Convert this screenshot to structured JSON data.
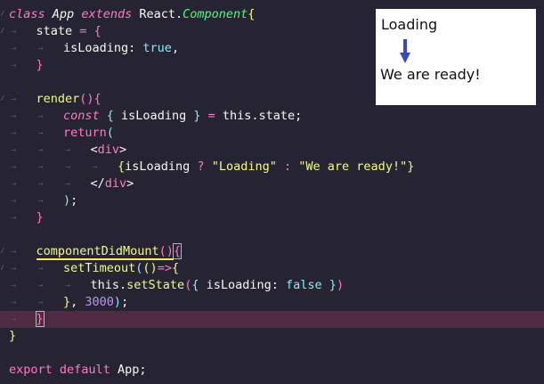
{
  "code_lines": [
    {
      "mark": "⁄",
      "tokens": [
        [
          "kw-i",
          "class"
        ],
        [
          "plain",
          " "
        ],
        [
          "cls",
          "App"
        ],
        [
          "plain",
          " "
        ],
        [
          "ext",
          "extends"
        ],
        [
          "plain",
          " "
        ],
        [
          "plain",
          "React"
        ],
        [
          "plain",
          "."
        ],
        [
          "inh",
          "Component"
        ],
        [
          "br-y",
          "{"
        ]
      ]
    },
    {
      "mark": "⁄",
      "indent": 1,
      "tokens": [
        [
          "plain",
          "state"
        ],
        [
          "plain",
          " "
        ],
        [
          "op",
          "="
        ],
        [
          "plain",
          " "
        ],
        [
          "br-p",
          "{"
        ]
      ]
    },
    {
      "mark": "",
      "indent": 2,
      "tokens": [
        [
          "plain",
          "isLoading"
        ],
        [
          "plain",
          ": "
        ],
        [
          "const",
          "true"
        ],
        [
          "plain",
          ","
        ]
      ]
    },
    {
      "mark": "",
      "indent": 1,
      "tokens": [
        [
          "br-p",
          "}"
        ]
      ]
    },
    {
      "mark": "",
      "indent": 0,
      "tokens": []
    },
    {
      "mark": "⁄",
      "indent": 1,
      "tokens": [
        [
          "yel",
          "render"
        ],
        [
          "br-p",
          "()"
        ],
        [
          "br-p",
          "{"
        ]
      ]
    },
    {
      "mark": "",
      "indent": 2,
      "tokens": [
        [
          "kw-i",
          "const"
        ],
        [
          "plain",
          " "
        ],
        [
          "br-b",
          "{"
        ],
        [
          "plain",
          " isLoading "
        ],
        [
          "br-b",
          "}"
        ],
        [
          "plain",
          " "
        ],
        [
          "op",
          "="
        ],
        [
          "plain",
          " this"
        ],
        [
          "plain",
          "."
        ],
        [
          "plain",
          "state"
        ],
        [
          "plain",
          ";"
        ]
      ]
    },
    {
      "mark": "",
      "indent": 2,
      "tokens": [
        [
          "kw",
          "return"
        ],
        [
          "br-b",
          "("
        ]
      ]
    },
    {
      "mark": "",
      "indent": 3,
      "tokens": [
        [
          "plain",
          "<"
        ],
        [
          "tag",
          "div"
        ],
        [
          "plain",
          ">"
        ]
      ]
    },
    {
      "mark": "",
      "indent": 4,
      "tokens": [
        [
          "br-y",
          "{"
        ],
        [
          "plain",
          "isLoading "
        ],
        [
          "op",
          "?"
        ],
        [
          "plain",
          " "
        ],
        [
          "str",
          "\"Loading\""
        ],
        [
          "plain",
          " "
        ],
        [
          "op",
          ":"
        ],
        [
          "plain",
          " "
        ],
        [
          "str",
          "\"We are ready!\""
        ],
        [
          "br-y",
          "}"
        ]
      ]
    },
    {
      "mark": "",
      "indent": 3,
      "tokens": [
        [
          "plain",
          "</"
        ],
        [
          "tag",
          "div"
        ],
        [
          "plain",
          ">"
        ]
      ]
    },
    {
      "mark": "",
      "indent": 2,
      "tokens": [
        [
          "br-b",
          ")"
        ],
        [
          "plain",
          ";"
        ]
      ]
    },
    {
      "mark": "",
      "indent": 1,
      "tokens": [
        [
          "br-p",
          "}"
        ]
      ]
    },
    {
      "mark": "",
      "indent": 0,
      "tokens": []
    },
    {
      "mark": "⁄",
      "indent": 1,
      "tokens": [
        [
          "yel method-ul",
          "componentDidMount"
        ],
        [
          "br-p method-ul",
          "()"
        ],
        [
          "br-p bracket-hl",
          "{"
        ]
      ]
    },
    {
      "mark": "⁄",
      "indent": 2,
      "tokens": [
        [
          "yel",
          "setTimeout"
        ],
        [
          "br-b",
          "("
        ],
        [
          "br-y",
          "()"
        ],
        [
          "op",
          "=>"
        ],
        [
          "br-y",
          "{"
        ]
      ]
    },
    {
      "mark": "",
      "indent": 3,
      "tokens": [
        [
          "plain",
          "this"
        ],
        [
          "plain",
          "."
        ],
        [
          "yel",
          "setState"
        ],
        [
          "br-p",
          "("
        ],
        [
          "br-b",
          "{"
        ],
        [
          "plain",
          " isLoading: "
        ],
        [
          "const",
          "false"
        ],
        [
          "plain",
          " "
        ],
        [
          "br-b",
          "}"
        ],
        [
          "br-p",
          ")"
        ]
      ]
    },
    {
      "mark": "",
      "indent": 2,
      "tokens": [
        [
          "br-y",
          "}"
        ],
        [
          "plain",
          ", "
        ],
        [
          "num",
          "3000"
        ],
        [
          "br-b",
          ")"
        ],
        [
          "plain",
          ";"
        ]
      ]
    },
    {
      "mark": "",
      "indent": 1,
      "current": true,
      "tokens": [
        [
          "br-p bracket-hl",
          "}"
        ]
      ]
    },
    {
      "mark": "",
      "indent": 0,
      "tokens": [
        [
          "br-y",
          "}"
        ]
      ]
    },
    {
      "mark": "",
      "indent": 0,
      "tokens": []
    },
    {
      "mark": "",
      "indent": 0,
      "tokens": [
        [
          "kw",
          "export"
        ],
        [
          "plain",
          " "
        ],
        [
          "kw",
          "default"
        ],
        [
          "plain",
          " App;"
        ]
      ]
    }
  ],
  "preview": {
    "loading_text": "Loading",
    "ready_text": "We are ready!",
    "arrow_color": "#3a46c8"
  }
}
